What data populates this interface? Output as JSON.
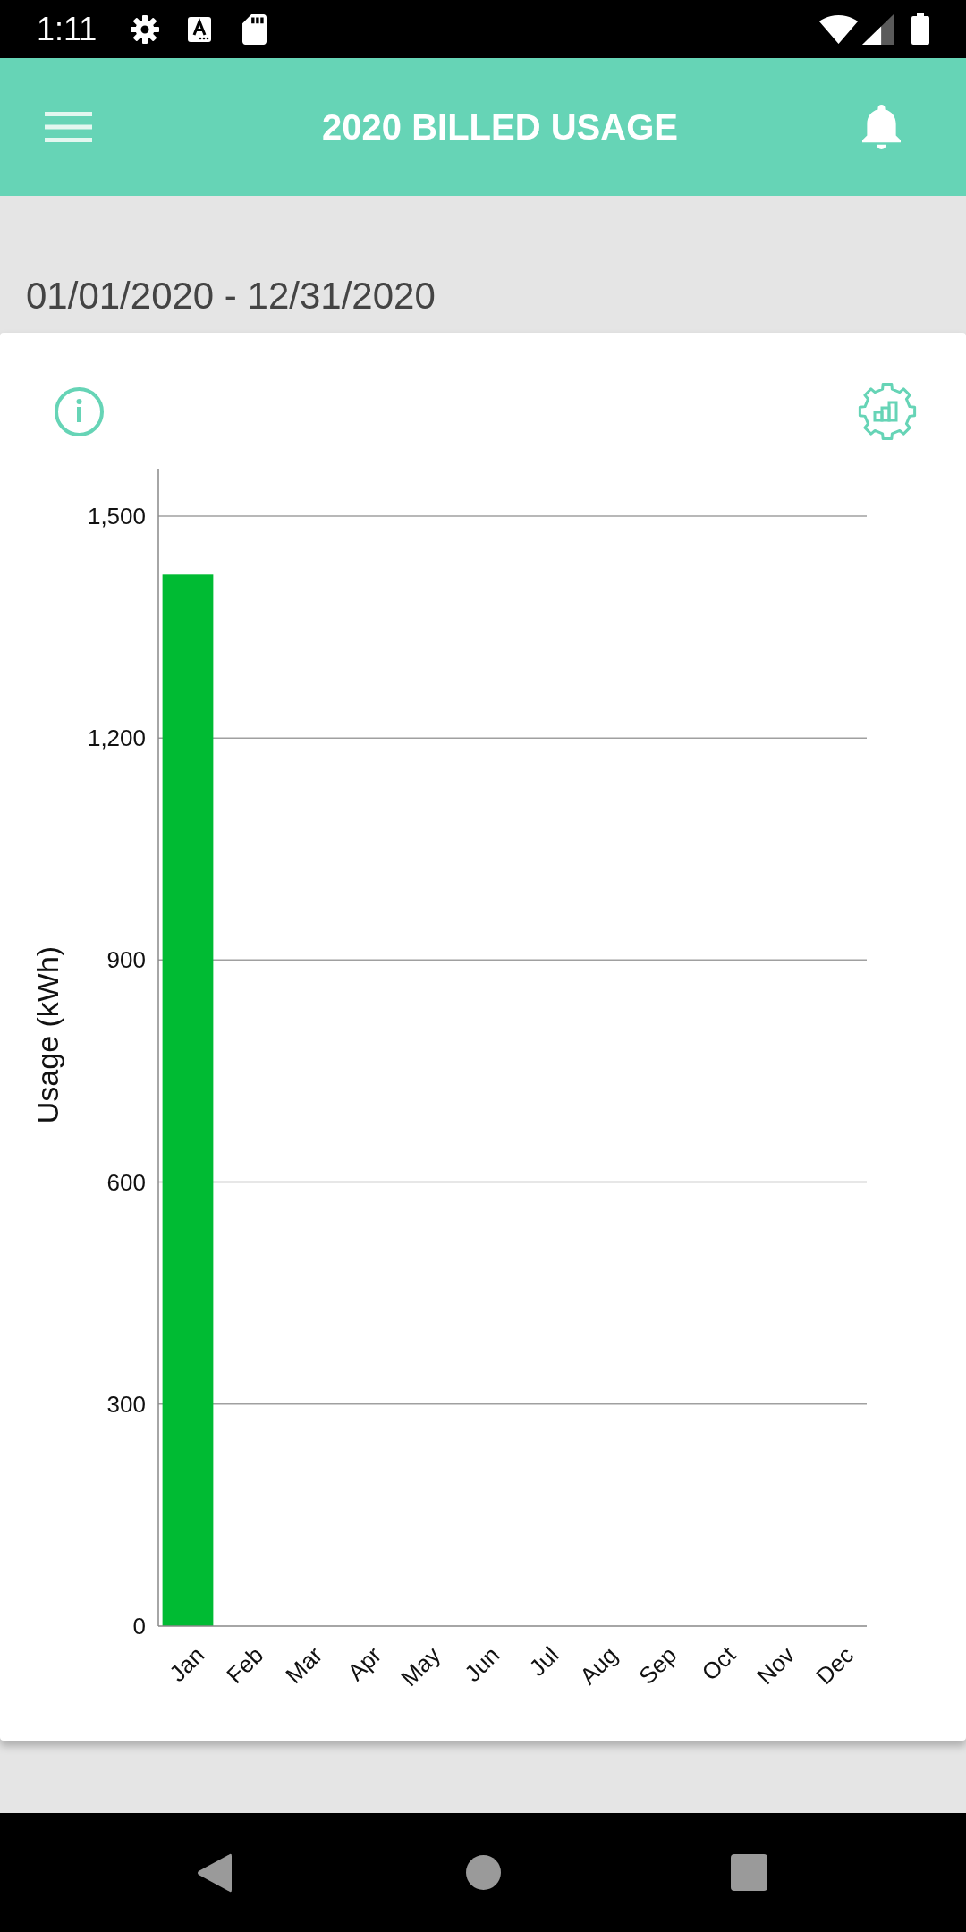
{
  "status_bar": {
    "time": "1:11"
  },
  "app_bar": {
    "title": "2020 BILLED USAGE"
  },
  "date_range": "01/01/2020 - 12/31/2020",
  "chart": {
    "chart_data": {
      "type": "bar",
      "grid": true,
      "ylabel": "Usage (kWh)",
      "categories": [
        "Jan",
        "Feb",
        "Mar",
        "Apr",
        "May",
        "Jun",
        "Jul",
        "Aug",
        "Sep",
        "Oct",
        "Nov",
        "Dec"
      ],
      "series": [
        {
          "color": "#00bb33",
          "values": [
            1421,
            null,
            null,
            null,
            null,
            null,
            null,
            null,
            null,
            null,
            null,
            null
          ]
        }
      ],
      "ylim": [
        0,
        1564
      ],
      "yticks": [
        {
          "value": 0,
          "label": "0"
        },
        {
          "value": 300,
          "label": "300"
        },
        {
          "value": 600,
          "label": "600"
        },
        {
          "value": 900,
          "label": "900"
        },
        {
          "value": 1200,
          "label": "1,200"
        },
        {
          "value": 1500,
          "label": "1,500"
        }
      ]
    }
  }
}
